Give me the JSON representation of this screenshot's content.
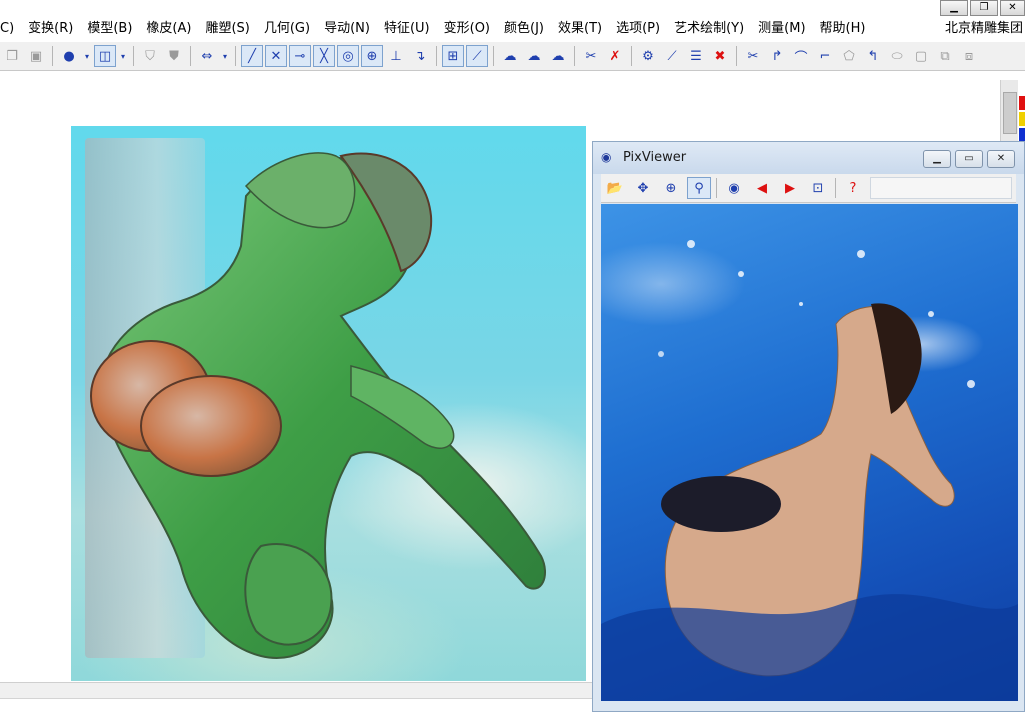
{
  "menu": {
    "items": [
      "C)",
      "变换(R)",
      "模型(B)",
      "橡皮(A)",
      "雕塑(S)",
      "几何(G)",
      "导动(N)",
      "特征(U)",
      "变形(O)",
      "颜色(J)",
      "效果(T)",
      "选项(P)",
      "艺术绘制(Y)",
      "测量(M)",
      "帮助(H)"
    ],
    "right_text": "北京精雕集团"
  },
  "pixviewer": {
    "title": "PixViewer"
  },
  "colors": {
    "toolbar_icon": "#1f3fae",
    "delete_red": "#dd1111",
    "palette": [
      "#e01010",
      "#f0d000",
      "#1030d0",
      "#ffffff"
    ]
  },
  "icons": {
    "main_toolbar": [
      "copy-icon",
      "paste-icon",
      "sphere-icon",
      "cube-icon",
      "shade-icon",
      "shade2-icon",
      "arrows-icon",
      "line-icon",
      "polyline-icon",
      "segment-icon",
      "cross-icon",
      "circle-icon",
      "target-icon",
      "axis-icon",
      "fold-icon",
      "grid-icon",
      "graph-icon",
      "cloud1-icon",
      "cloud2-icon",
      "cloud3-icon",
      "cut-icon",
      "delete-cut-icon",
      "point-icon",
      "gear-icon",
      "doc-icon",
      "delete-icon",
      "scissors-icon",
      "curve-icon",
      "arc-icon",
      "corner-icon",
      "chamfer-icon",
      "fillet-icon",
      "ellipse-icon",
      "square-icon",
      "copy-square-icon",
      "layer-icon"
    ],
    "pix_toolbar": [
      "folder-open-icon",
      "move-icon",
      "zoom-in-icon",
      "zoom-icon",
      "eye-icon",
      "prev-icon",
      "next-icon",
      "zoom-fit-icon",
      "help-icon"
    ]
  }
}
